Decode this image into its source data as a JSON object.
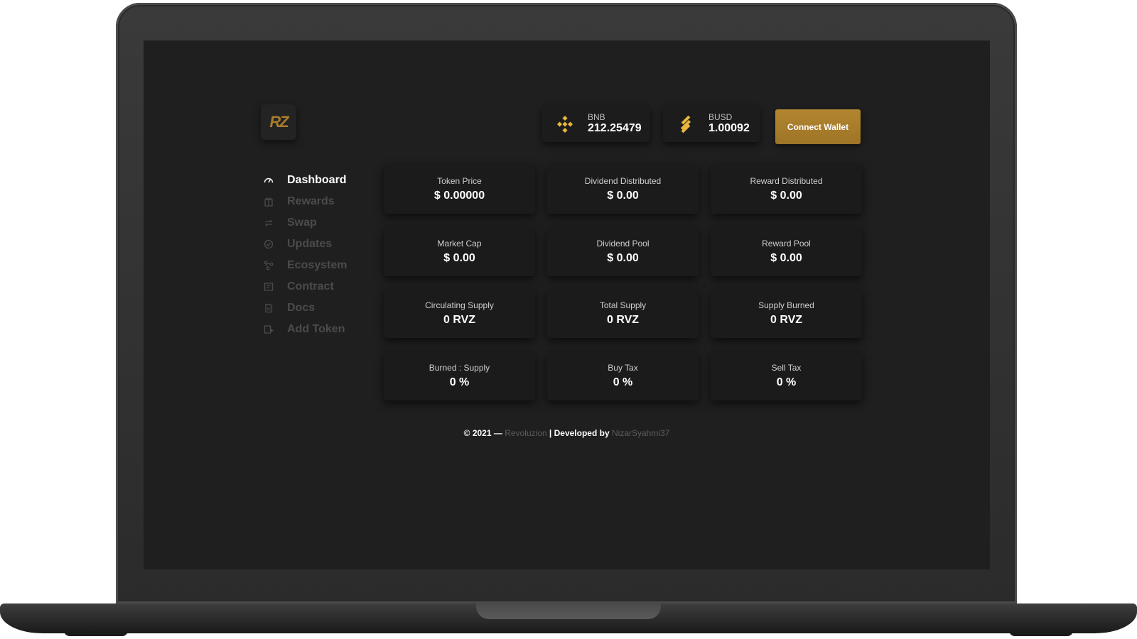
{
  "app": {
    "logo": "RZ"
  },
  "header": {
    "prices": [
      {
        "symbol": "BNB",
        "value": "212.25479",
        "icon": "binance-diamond-icon"
      },
      {
        "symbol": "BUSD",
        "value": "1.00092",
        "icon": "binance-stripes-icon"
      }
    ],
    "connect_label": "Connect Wallet"
  },
  "sidebar": {
    "items": [
      {
        "label": "Dashboard",
        "icon": "speedometer-icon",
        "active": true
      },
      {
        "label": "Rewards",
        "icon": "rewards-icon"
      },
      {
        "label": "Swap",
        "icon": "swap-icon"
      },
      {
        "label": "Updates",
        "icon": "updates-icon"
      },
      {
        "label": "Ecosystem",
        "icon": "ecosystem-icon"
      },
      {
        "label": "Contract",
        "icon": "contract-icon"
      },
      {
        "label": "Docs",
        "icon": "docs-icon"
      },
      {
        "label": "Add Token",
        "icon": "add-token-icon"
      }
    ]
  },
  "stats": [
    {
      "label": "Token Price",
      "value": "$ 0.00000"
    },
    {
      "label": "Dividend Distributed",
      "value": "$ 0.00"
    },
    {
      "label": "Reward Distributed",
      "value": "$ 0.00"
    },
    {
      "label": "Market Cap",
      "value": "$ 0.00"
    },
    {
      "label": "Dividend Pool",
      "value": "$ 0.00"
    },
    {
      "label": "Reward Pool",
      "value": "$ 0.00"
    },
    {
      "label": "Circulating Supply",
      "value": "0 RVZ"
    },
    {
      "label": "Total Supply",
      "value": "0 RVZ"
    },
    {
      "label": "Supply Burned",
      "value": "0 RVZ"
    },
    {
      "label": "Burned : Supply",
      "value": "0 %"
    },
    {
      "label": "Buy Tax",
      "value": "0 %"
    },
    {
      "label": "Sell Tax",
      "value": "0 %"
    }
  ],
  "footer": {
    "copyright": "© 2021 —",
    "brand": "Revoluzion",
    "developed_by": "| Developed by",
    "developer": "NizarSyahmi37"
  },
  "colors": {
    "accent": "#a87d2c",
    "background": "#1f1f1f",
    "card": "#1b1b1b",
    "muted": "#4b4b4b"
  }
}
